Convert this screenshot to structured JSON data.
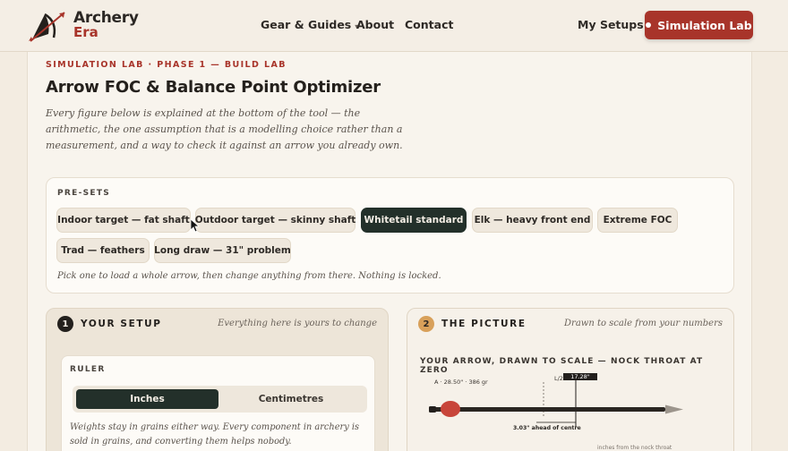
{
  "header": {
    "brand_line1": "Archery",
    "brand_line2": "Era",
    "nav": [
      {
        "label": "Gear & Guides",
        "caret": "▾"
      },
      {
        "label": "About"
      },
      {
        "label": "Contact"
      },
      {
        "label": "My Setups"
      }
    ],
    "cta_label": "Simulation Lab"
  },
  "page": {
    "eyebrow": "SIMULATION LAB · PHASE 1 — BUILD LAB",
    "title": "Arrow FOC & Balance Point Optimizer",
    "lede": "Every figure below is explained at the bottom of the tool — the arithmetic, the one assumption that is a modelling choice rather than a measurement, and a way to check it against an arrow you already own."
  },
  "presets": {
    "label": "PRE-SETS",
    "items": [
      {
        "label": "Indoor target — fat shaft",
        "active": false
      },
      {
        "label": "Outdoor target — skinny shaft",
        "active": false
      },
      {
        "label": "Whitetail standard",
        "active": true
      },
      {
        "label": "Elk — heavy front end",
        "active": false
      },
      {
        "label": "Extreme FOC",
        "active": false
      },
      {
        "label": "Trad — feathers",
        "active": false
      },
      {
        "label": "Long draw — 31\" problem",
        "active": false
      }
    ],
    "hint": "Pick one to load a whole arrow, then change anything from there. Nothing is locked."
  },
  "setup_panel": {
    "number": "1",
    "title": "YOUR SETUP",
    "note": "Everything here is yours to change",
    "ruler": {
      "label": "RULER",
      "options": [
        "Inches",
        "Centimetres"
      ],
      "selected": "Inches",
      "hint": "Weights stay in grains either way. Every component in archery is sold in grains, and converting them helps nobody."
    }
  },
  "picture_panel": {
    "number": "2",
    "title": "THE PICTURE",
    "note": "Drawn to scale from your numbers",
    "diagram_label": "YOUR ARROW, DRAWN TO SCALE — NOCK THROAT AT ZERO",
    "balance_label": "A · 28.50\" · 386 gr",
    "half_label": "L/2",
    "length_badge": "17.28\"",
    "foc_offset_label": "3.03\" ahead of centre",
    "footnote": "inches from the nock throat"
  },
  "colors": {
    "accent": "#a8342a",
    "dark": "#23302a",
    "cream": "#f4eee5"
  }
}
